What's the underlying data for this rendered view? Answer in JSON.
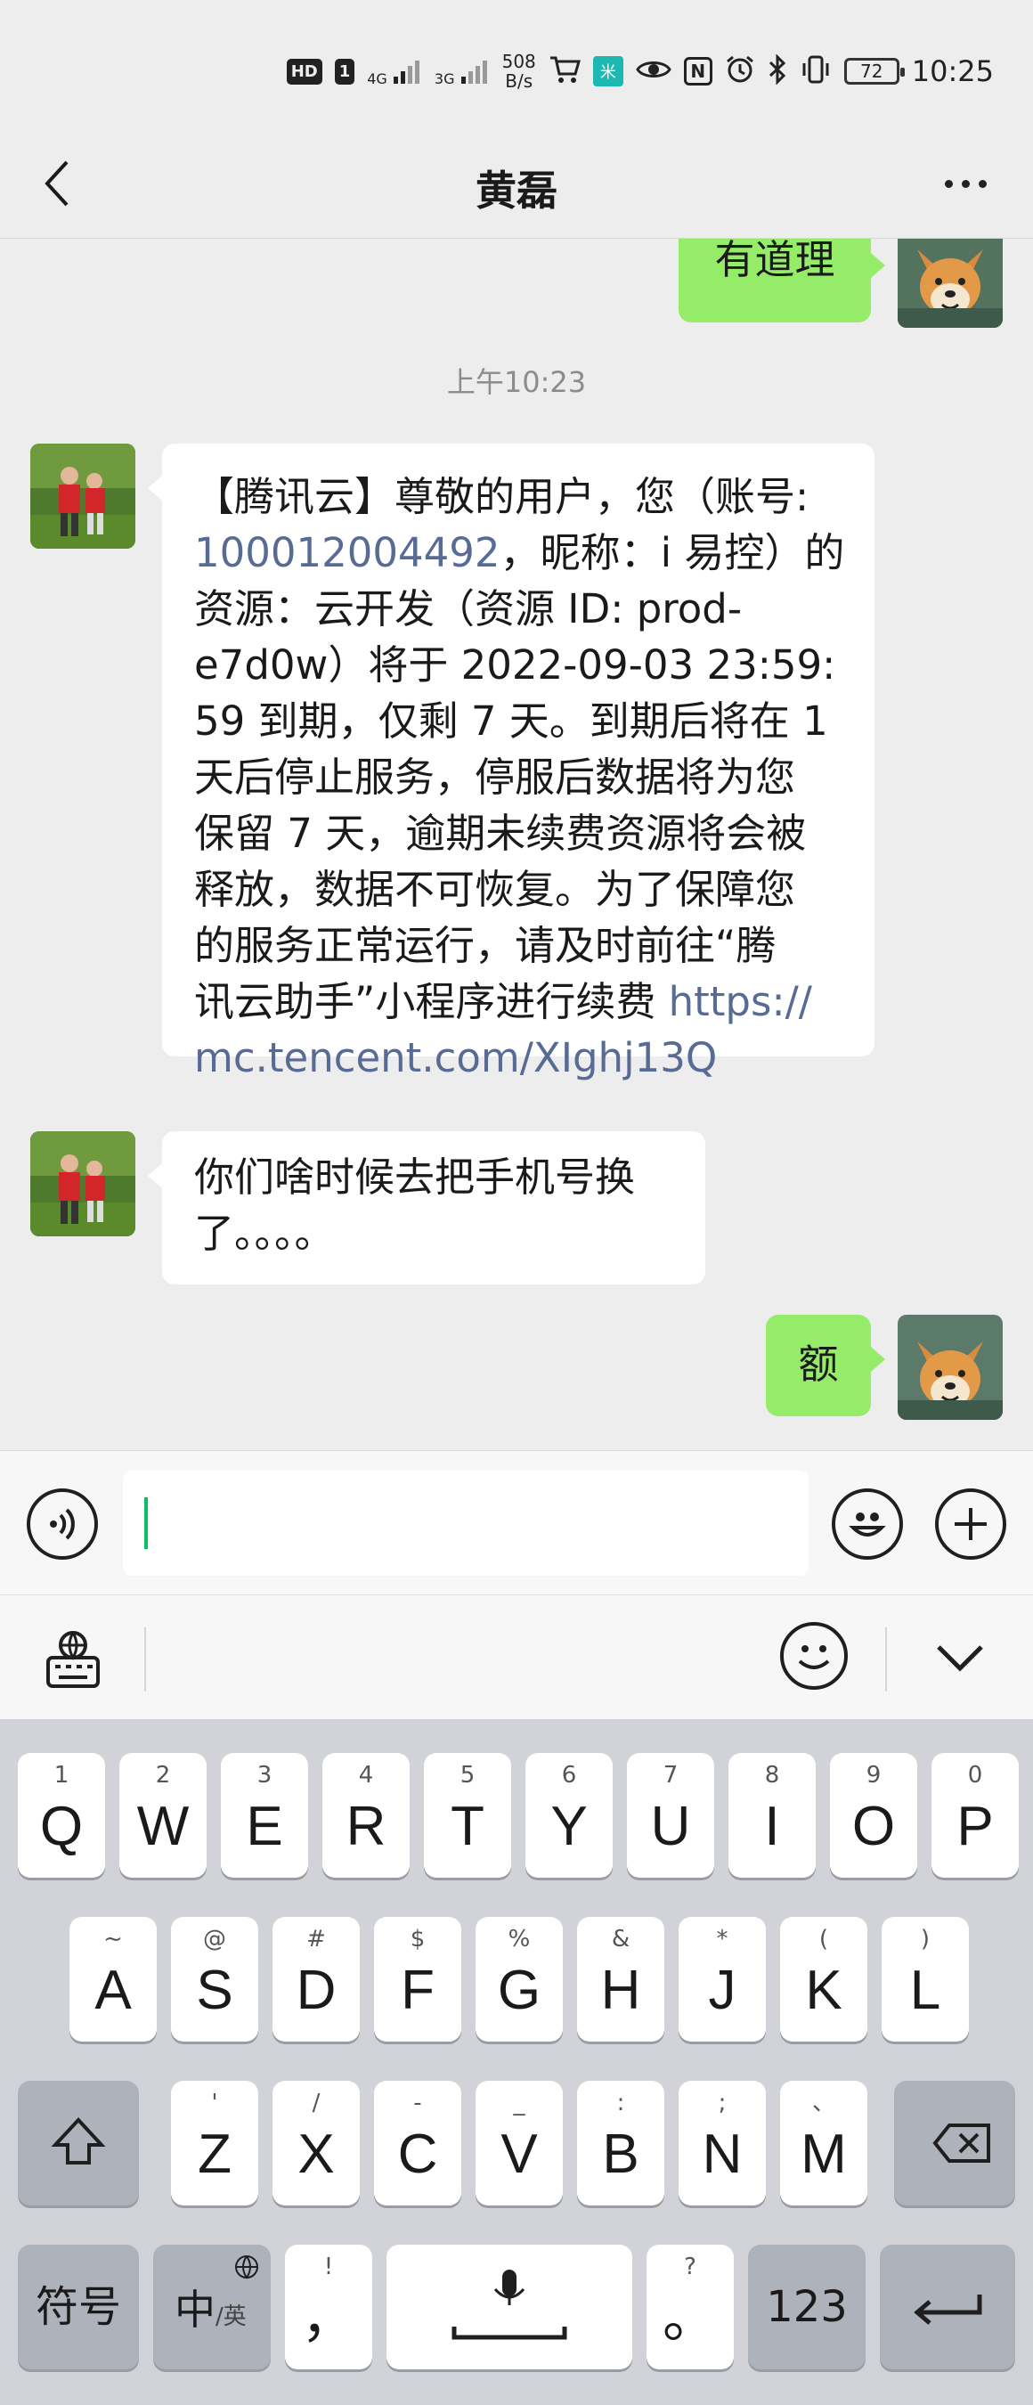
{
  "status_bar": {
    "hd": "HD",
    "sim": "1",
    "net1": "4G",
    "net2": "3G",
    "speed_value": "508",
    "speed_unit": "B/s",
    "mi_label": "米",
    "nfc": "N",
    "battery": "72",
    "time": "10:25"
  },
  "header": {
    "title": "黄磊"
  },
  "messages": {
    "m1_text": "有道理",
    "timestamp": "上午10:23",
    "m2_lines": [
      "【腾讯云】尊敬的用户，您（账号:",
      "100012004492，昵称：i 易控）的",
      "资源：云开发（资源 ID: prod-",
      "e7d0w）将于 2022-09-03 23:59:",
      "59 到期，仅剩 7 天。到期后将在 1",
      "天后停止服务，停服后数据将为您",
      "保留 7 天，逾期未续费资源将会被",
      "释放，数据不可恢复。为了保障您",
      "的服务正常运行，请及时前往“腾",
      "讯云助手”小程序进行续费 https://",
      "mc.tencent.com/XIghj13Q"
    ],
    "m2_link_account": "100012004492",
    "m2_link_url_part1": "https://",
    "m2_link_url_part2": "mc.tencent.com/XIghj13Q",
    "m3_lines": [
      "你们啥时候去把手机号换",
      "了。。。。"
    ],
    "m4_text": "额"
  },
  "input": {
    "value": ""
  },
  "keyboard": {
    "row1": [
      {
        "main": "Q",
        "sub": "1"
      },
      {
        "main": "W",
        "sub": "2"
      },
      {
        "main": "E",
        "sub": "3"
      },
      {
        "main": "R",
        "sub": "4"
      },
      {
        "main": "T",
        "sub": "5"
      },
      {
        "main": "Y",
        "sub": "6"
      },
      {
        "main": "U",
        "sub": "7"
      },
      {
        "main": "I",
        "sub": "8"
      },
      {
        "main": "O",
        "sub": "9"
      },
      {
        "main": "P",
        "sub": "0"
      }
    ],
    "row2": [
      {
        "main": "A",
        "sub": "~"
      },
      {
        "main": "S",
        "sub": "@"
      },
      {
        "main": "D",
        "sub": "#"
      },
      {
        "main": "F",
        "sub": "$"
      },
      {
        "main": "G",
        "sub": "%"
      },
      {
        "main": "H",
        "sub": "&"
      },
      {
        "main": "J",
        "sub": "*"
      },
      {
        "main": "K",
        "sub": "("
      },
      {
        "main": "L",
        "sub": ")"
      }
    ],
    "row3": [
      {
        "main": "Z",
        "sub": "'"
      },
      {
        "main": "X",
        "sub": "/"
      },
      {
        "main": "C",
        "sub": "-"
      },
      {
        "main": "V",
        "sub": "_"
      },
      {
        "main": "B",
        "sub": ":"
      },
      {
        "main": "N",
        "sub": ";"
      },
      {
        "main": "M",
        "sub": "、"
      }
    ],
    "symbols_label": "符号",
    "lang_label": "中",
    "lang_sub": "/英",
    "comma_main": "，",
    "comma_sub": "!",
    "period_main": "。",
    "period_sub": "?",
    "numbers_label": "123"
  },
  "colors": {
    "chat_bg": "#ededed",
    "sent_bubble": "#95ec69",
    "received_bubble": "#ffffff",
    "link": "#576b95",
    "keyboard_bg": "#d1d3d9"
  }
}
